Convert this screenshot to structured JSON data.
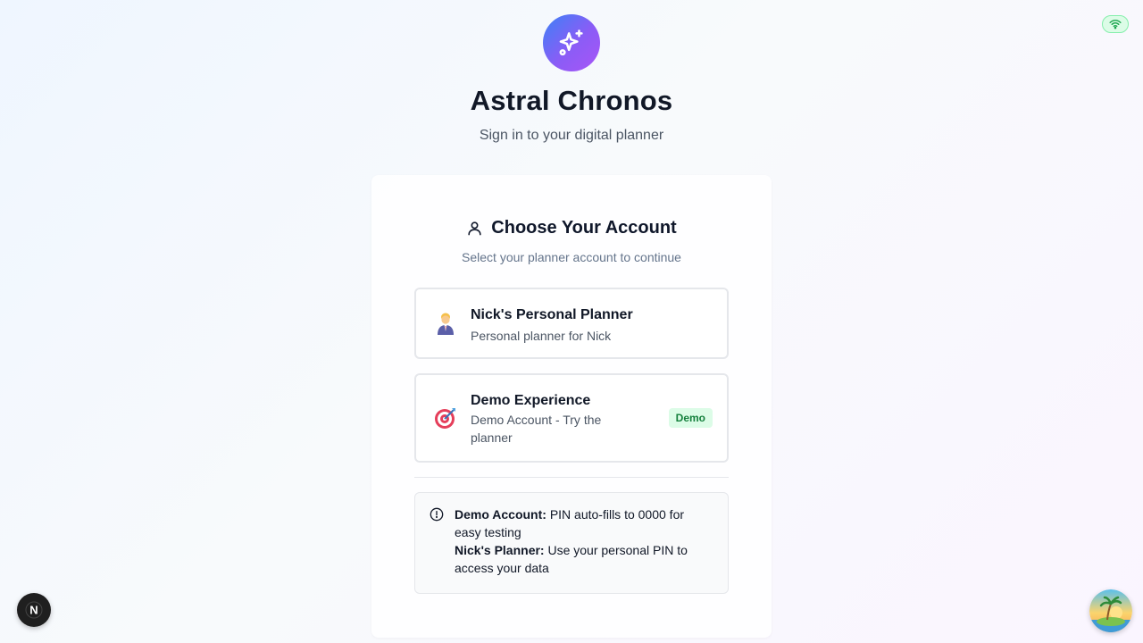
{
  "app": {
    "title": "Astral Chronos",
    "subtitle": "Sign in to your digital planner",
    "logo_icon": "sparkles-icon"
  },
  "account_picker": {
    "heading": "Choose Your Account",
    "heading_icon": "user-icon",
    "subheading": "Select your planner account to continue",
    "accounts": [
      {
        "icon": "person-in-suit-emoji",
        "name": "Nick's Personal Planner",
        "description": "Personal planner for Nick"
      },
      {
        "icon": "direct-hit-target-emoji",
        "name": "Demo Experience",
        "description": "Demo Account - Try the planner",
        "badge": "Demo"
      }
    ]
  },
  "info_box": {
    "icon": "info-circle-icon",
    "demo_label": "Demo Account:",
    "demo_text": "PIN auto-fills to 0000 for easy testing",
    "nick_label": "Nick's Planner:",
    "nick_text": "Use your personal PIN to access your data"
  },
  "widgets": {
    "wifi_icon": "wifi-icon",
    "next_badge_letter": "N",
    "avatar_icon": "island-sunset-avatar"
  },
  "colors": {
    "logo_gradient_start": "#3b82f6",
    "logo_gradient_end": "#a855f7",
    "badge_bg": "#dcfce7",
    "badge_text": "#15803d"
  }
}
